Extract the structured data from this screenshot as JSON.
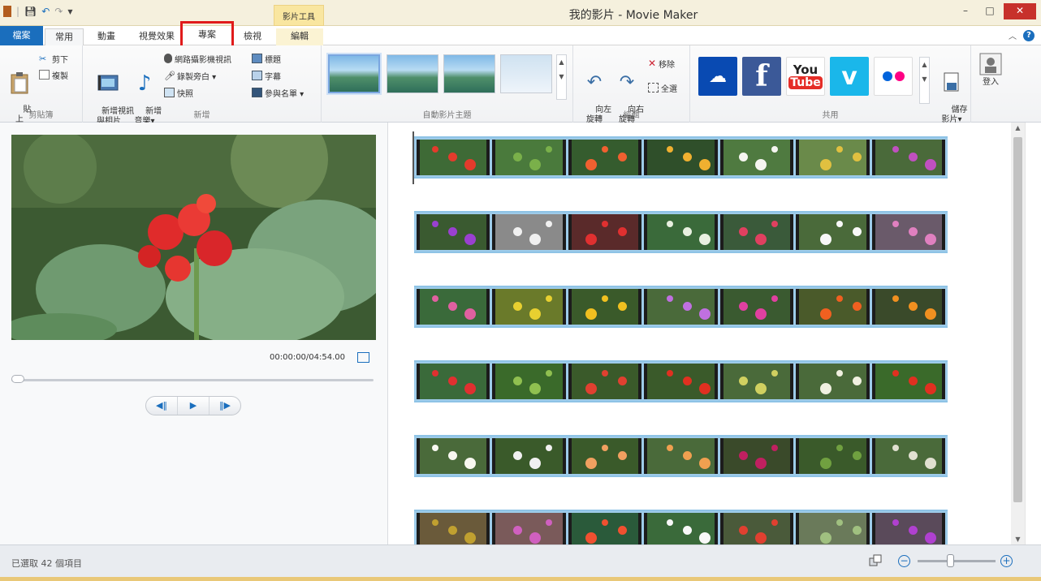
{
  "window": {
    "title": "我的影片 - Movie Maker",
    "contextual_tab_group": "影片工具",
    "controls": {
      "minimize": "–",
      "maximize": "□",
      "close": "✕"
    }
  },
  "tabs": [
    {
      "label": "檔案"
    },
    {
      "label": "常用"
    },
    {
      "label": "動畫"
    },
    {
      "label": "視覺效果"
    },
    {
      "label": "專案"
    },
    {
      "label": "檢視"
    },
    {
      "label": "編輯"
    }
  ],
  "ribbon": {
    "clipboard": {
      "label": "剪貼簿",
      "paste": "貼\n上",
      "cut": "剪下",
      "copy": "複製"
    },
    "add": {
      "label": "新增",
      "add_videos_photos": "新增視訊\n與相片",
      "add_music": "新增\n音樂▾",
      "webcam_video": "網路攝影機視訊",
      "record_narration": "錄製旁白 ▾",
      "snapshot": "快照",
      "title": "標題",
      "caption": "字幕",
      "credits": "參與名單 ▾"
    },
    "themes": {
      "label": "自動影片主題"
    },
    "editing": {
      "label": "編輯",
      "rotate_left": "向左\n旋轉",
      "rotate_right": "向右\n旋轉",
      "remove": "移除",
      "select_all": "全選"
    },
    "share": {
      "label": "共用",
      "youtube": "You",
      "youtube2": "Tube",
      "facebook": "f",
      "save_movie": "儲存\n影片▾",
      "sign_in": "登入"
    }
  },
  "preview": {
    "time": "00:00:00/04:54.00",
    "seek_progress": 0
  },
  "status": {
    "text": "已選取 42 個項目"
  },
  "colors": {
    "file_tab": "#1a6ebd",
    "highlight_box": "#e01b1b",
    "onedrive": "#094ab2",
    "facebook": "#3b5998",
    "youtube": "#e52d27",
    "vimeo": "#1ab7ea",
    "flickr_blue": "#0063dc",
    "flickr_pink": "#ff0084"
  }
}
